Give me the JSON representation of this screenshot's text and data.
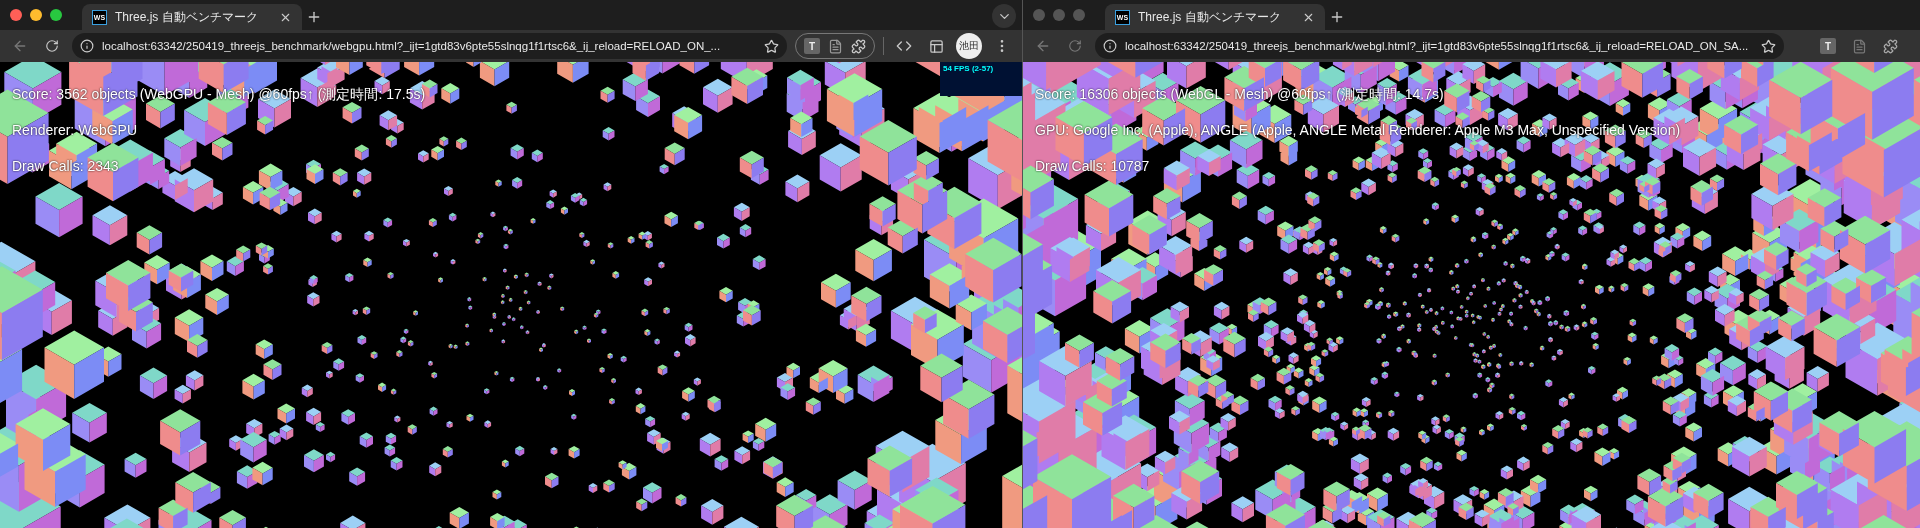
{
  "windows": [
    {
      "active": true,
      "tab": {
        "favicon": "WS",
        "title": "Three.js 自動ベンチマーク"
      },
      "url": "localhost:63342/250419_threejs_benchmark/webgpu.html?_ijt=1gtd83v6pte55slnqg1f1rtsc6&_ij_reload=RELOAD_ON_...",
      "extension_badge": "T",
      "profile": "池田",
      "overlay": [
        "Score: 3562 objects (WebGPU - Mesh) @60fps↑ (測定時間: 17.5s)",
        "Renderer: WebGPU",
        "Draw Calls: 2343"
      ],
      "stats": "54 FPS (2-57)"
    },
    {
      "active": false,
      "tab": {
        "favicon": "WS",
        "title": "Three.js 自動ベンチマーク"
      },
      "url": "localhost:63342/250419_threejs_benchmark/webgl.html?_ijt=1gtd83v6pte55slnqg1f1rtsc6&_ij_reload=RELOAD_ON_SA...",
      "extension_badge": "T",
      "overlay": [
        "Score: 16306 objects (WebGL - Mesh) @60fps↑ (測定時間: 14.7s)",
        "GPU: Google Inc. (Apple), ANGLE (Apple, ANGLE Metal Renderer: Apple M3 Max, Unspecified Version)",
        "Draw Calls: 10787"
      ]
    }
  ]
}
